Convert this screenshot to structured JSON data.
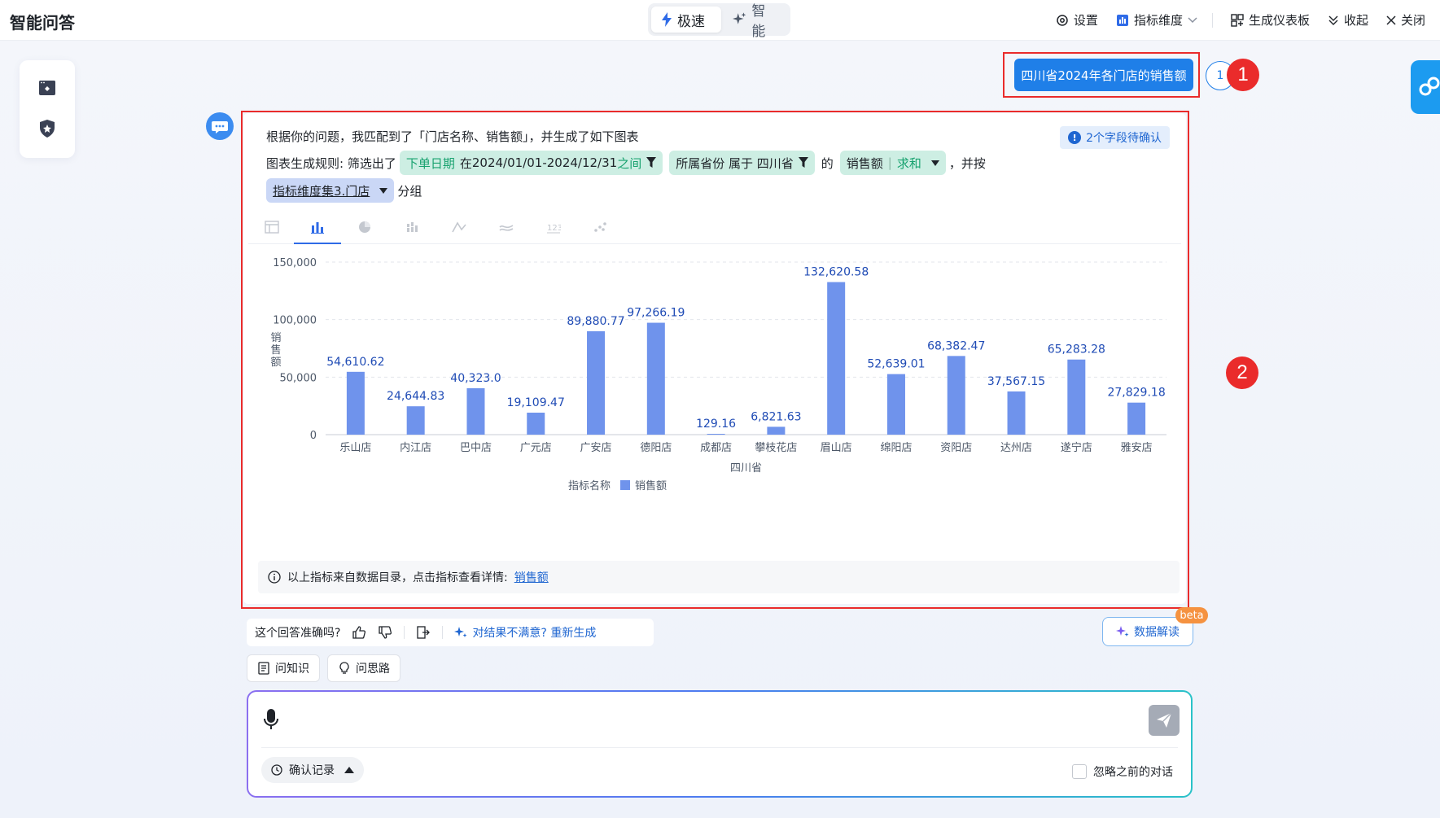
{
  "app": {
    "title": "智能问答"
  },
  "modes": [
    {
      "label": "极速",
      "active": true
    },
    {
      "label": "智能",
      "active": false
    }
  ],
  "toolbar": {
    "settings": "设置",
    "metric_dimension": "指标维度",
    "generate_dashboard": "生成仪表板",
    "collapse": "收起",
    "close": "关闭"
  },
  "annotations": {
    "badge_1": "1",
    "badge_2": "2"
  },
  "conversation": {
    "user_question": "四川省2024年各门店的销售额",
    "question_count": "1"
  },
  "answer": {
    "intro": "根据你的问题，我匹配到了「门店名称、销售额」，并生成了如下图表",
    "pending": "2个字段待确认",
    "rule_prefix": "图表生成规则: 筛选出了",
    "chip_date": {
      "field": "下单日期",
      "op": "在",
      "range": "2024/01/01-2024/12/31",
      "suffix": "之间"
    },
    "chip_province": {
      "text": "所属省份 属于 四川省"
    },
    "de": "的",
    "chip_metric": {
      "field": "销售额",
      "agg": "求和"
    },
    "and_by": "，并按",
    "chip_group": {
      "text": "指标维度集3.门店"
    },
    "group_suffix": "分组",
    "info_text": "以上指标来自数据目录，点击指标查看详情:",
    "info_link": "销售额"
  },
  "chart_tabs": [
    {
      "icon": "table-icon",
      "active": false
    },
    {
      "icon": "bar-chart-icon",
      "active": true
    },
    {
      "icon": "pie-chart-icon",
      "active": false
    },
    {
      "icon": "grouped-bar-icon",
      "active": false
    },
    {
      "icon": "line-chart-icon",
      "active": false
    },
    {
      "icon": "area-chart-icon",
      "active": false
    },
    {
      "icon": "number-card-icon",
      "active": false
    },
    {
      "icon": "scatter-icon",
      "active": false
    }
  ],
  "chart_data": {
    "type": "bar",
    "categories": [
      "乐山店",
      "内江店",
      "巴中店",
      "广元店",
      "广安店",
      "德阳店",
      "成都店",
      "攀枝花店",
      "眉山店",
      "绵阳店",
      "资阳店",
      "达州店",
      "遂宁店",
      "雅安店"
    ],
    "series": [
      {
        "name": "销售额",
        "values": [
          54610.62,
          24644.83,
          40323.0,
          19109.47,
          89880.77,
          97266.19,
          129.16,
          6821.63,
          132620.58,
          52639.01,
          68382.47,
          37567.15,
          65283.28,
          27829.18
        ]
      }
    ],
    "data_labels": [
      "54,610.62",
      "24,644.83",
      "40,323.0",
      "19,109.47",
      "89,880.77",
      "97,266.19",
      "129.16",
      "6,821.63",
      "132,620.58",
      "52,639.01",
      "68,382.47",
      "37,567.15",
      "65,283.28",
      "27,829.18"
    ],
    "y_ticks": [
      "0",
      "50,000",
      "100,000",
      "150,000"
    ],
    "y_tick_values": [
      0,
      50000,
      100000,
      150000
    ],
    "ylim": [
      0,
      150000
    ],
    "ylabel": "销售额",
    "xlabel": "四川省",
    "legend_title": "指标名称",
    "legend_label": "销售额",
    "legend_position": "bottom",
    "grid": true,
    "bar_color": "#6f93ec"
  },
  "feedback": {
    "question": "这个回答准确吗?",
    "regenerate": "对结果不满意? 重新生成",
    "data_interpret": "数据解读",
    "beta": "beta"
  },
  "quick_actions": {
    "ask_knowledge": "问知识",
    "ask_approach": "问思路"
  },
  "input": {
    "placeholder": "",
    "confirm_record": "确认记录",
    "ignore_previous": "忽略之前的对话"
  },
  "colors": {
    "accent": "#1f7fe8",
    "annotation_red": "#ea2b2b",
    "chip_green": "#cdeee3",
    "chip_blue": "#cad7f6"
  }
}
